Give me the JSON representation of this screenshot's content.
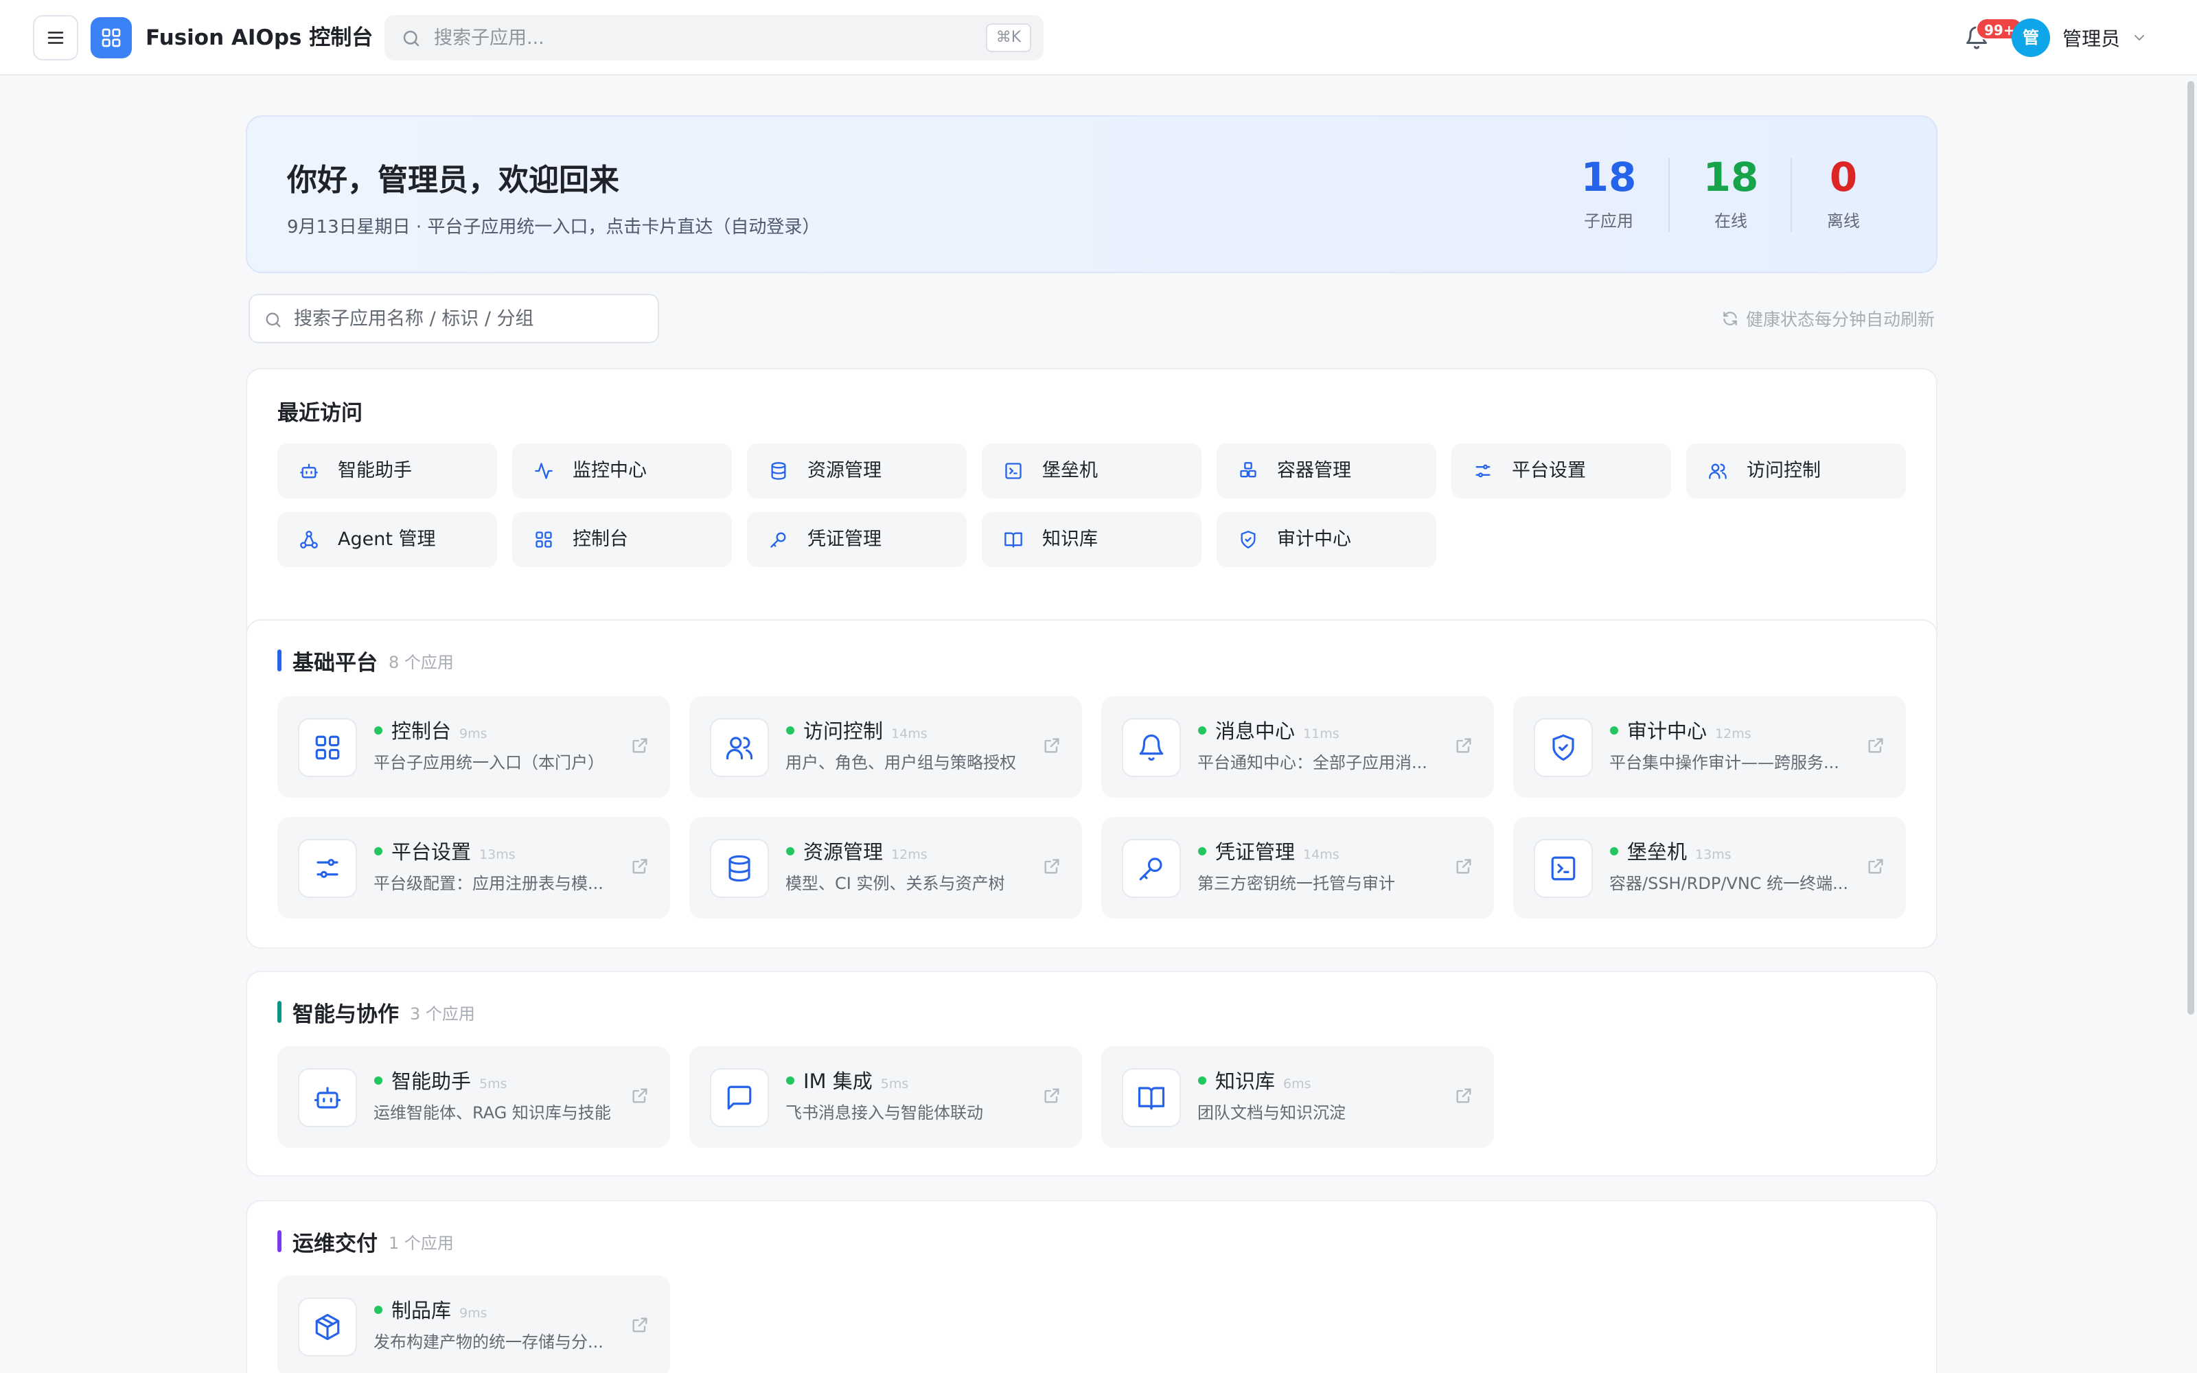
{
  "header": {
    "title": "Fusion AIOps 控制台",
    "search_placeholder": "搜索子应用...",
    "search_shortcut": "⌘K",
    "notification_badge": "99+",
    "user": {
      "avatar_text": "管",
      "name": "管理员"
    }
  },
  "welcome": {
    "title": "你好，管理员，欢迎回来",
    "subtitle": "9月13日星期日 · 平台子应用统一入口，点击卡片直达（自动登录）",
    "stats": [
      {
        "value": "18",
        "label": "子应用",
        "color": "#2563eb"
      },
      {
        "value": "18",
        "label": "在线",
        "color": "#16a34a"
      },
      {
        "value": "0",
        "label": "离线",
        "color": "#dc2626"
      }
    ]
  },
  "filter": {
    "placeholder": "搜索子应用名称 / 标识 / 分组",
    "refresh_note": "健康状态每分钟自动刷新"
  },
  "recent": {
    "title": "最近访问",
    "items": [
      {
        "label": "智能助手",
        "icon": "robot-icon"
      },
      {
        "label": "监控中心",
        "icon": "activity-icon"
      },
      {
        "label": "资源管理",
        "icon": "database-icon"
      },
      {
        "label": "堡垒机",
        "icon": "terminal-icon"
      },
      {
        "label": "容器管理",
        "icon": "containers-icon"
      },
      {
        "label": "平台设置",
        "icon": "sliders-icon"
      },
      {
        "label": "访问控制",
        "icon": "users-icon"
      },
      {
        "label": "Agent 管理",
        "icon": "network-icon"
      },
      {
        "label": "控制台",
        "icon": "grid-icon"
      },
      {
        "label": "凭证管理",
        "icon": "key-icon"
      },
      {
        "label": "知识库",
        "icon": "book-icon"
      },
      {
        "label": "审计中心",
        "icon": "shield-icon"
      }
    ]
  },
  "sections": [
    {
      "title": "基础平台",
      "count": "8 个应用",
      "accent": "#2563eb",
      "apps": [
        {
          "name": "控制台",
          "latency": "9ms",
          "desc": "平台子应用统一入口（本门户）",
          "icon": "grid-icon",
          "status": "online"
        },
        {
          "name": "访问控制",
          "latency": "14ms",
          "desc": "用户、角色、用户组与策略授权",
          "icon": "users-icon",
          "status": "online"
        },
        {
          "name": "消息中心",
          "latency": "11ms",
          "desc": "平台通知中心：全部子应用消...",
          "icon": "bell-icon",
          "status": "online"
        },
        {
          "name": "审计中心",
          "latency": "12ms",
          "desc": "平台集中操作审计——跨服务...",
          "icon": "shield-icon",
          "status": "online"
        },
        {
          "name": "平台设置",
          "latency": "13ms",
          "desc": "平台级配置：应用注册表与模...",
          "icon": "sliders-icon",
          "status": "online"
        },
        {
          "name": "资源管理",
          "latency": "12ms",
          "desc": "模型、CI 实例、关系与资产树",
          "icon": "database-icon",
          "status": "online"
        },
        {
          "name": "凭证管理",
          "latency": "14ms",
          "desc": "第三方密钥统一托管与审计",
          "icon": "key-icon",
          "status": "online"
        },
        {
          "name": "堡垒机",
          "latency": "13ms",
          "desc": "容器/SSH/RDP/VNC 统一终端...",
          "icon": "terminal-icon",
          "status": "online"
        }
      ]
    },
    {
      "title": "智能与协作",
      "count": "3 个应用",
      "accent": "#0d9488",
      "apps": [
        {
          "name": "智能助手",
          "latency": "5ms",
          "desc": "运维智能体、RAG 知识库与技能",
          "icon": "robot-icon",
          "status": "online"
        },
        {
          "name": "IM 集成",
          "latency": "5ms",
          "desc": "飞书消息接入与智能体联动",
          "icon": "message-icon",
          "status": "online"
        },
        {
          "name": "知识库",
          "latency": "6ms",
          "desc": "团队文档与知识沉淀",
          "icon": "book-icon",
          "status": "online"
        }
      ]
    },
    {
      "title": "运维交付",
      "count": "1 个应用",
      "accent": "#7c3aed",
      "apps": [
        {
          "name": "制品库",
          "latency": "9ms",
          "desc": "发布构建产物的统一存储与分...",
          "icon": "package-icon",
          "status": "online"
        }
      ]
    }
  ],
  "colors": {
    "brand": "#3b82f6",
    "online": "#22c55e",
    "icon_blue": "#2563eb"
  }
}
